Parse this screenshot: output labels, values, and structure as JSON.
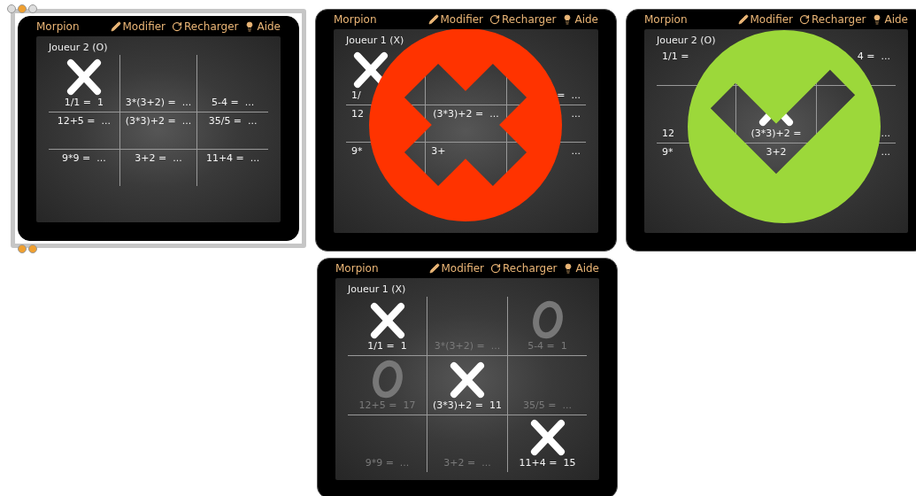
{
  "widgets": [
    {
      "title": "Morpion",
      "editing": true,
      "kind": "plain",
      "toolbar": [
        {
          "kind": "edit",
          "label": "Modifier"
        },
        {
          "kind": "reload",
          "label": "Recharger"
        },
        {
          "kind": "help",
          "label": "Aide"
        }
      ],
      "player": "Joueur 2 (O)",
      "cells": [
        {
          "kind": "cross",
          "text": "1/1 =  1",
          "dimmed": false
        },
        {
          "kind": "empty",
          "text": "3*(3+2) =  ...",
          "dimmed": false
        },
        {
          "kind": "empty",
          "text": "5-4 =  ...",
          "dimmed": false
        },
        {
          "kind": "empty",
          "text": "12+5 =  ...",
          "dimmed": false
        },
        {
          "kind": "empty",
          "text": "(3*3)+2 =  ...",
          "dimmed": false
        },
        {
          "kind": "empty",
          "text": "35/5 =  ...",
          "dimmed": false
        },
        {
          "kind": "empty",
          "text": "9*9 =  ...",
          "dimmed": false
        },
        {
          "kind": "empty",
          "text": "3+2 =  ...",
          "dimmed": false
        },
        {
          "kind": "empty",
          "text": "11+4 =  ...",
          "dimmed": false
        }
      ]
    },
    {
      "title": "Morpion",
      "editing": false,
      "kind": "wrong",
      "toolbar": [
        {
          "kind": "edit",
          "label": "Modifier"
        },
        {
          "kind": "reload",
          "label": "Recharger"
        },
        {
          "kind": "help",
          "label": "Aide"
        }
      ],
      "player": "Joueur 1 (X)",
      "cells": [
        {
          "kind": "cross",
          "text": "1/",
          "dimmed": false
        },
        {
          "kind": "empty"
        },
        {
          "kind": "empty",
          "text": "=  ...",
          "dimmed": false
        },
        {
          "kind": "empty",
          "text": "12",
          "dimmed": false
        },
        {
          "kind": "empty",
          "text": "(3*3)+2 =  ...",
          "dimmed": false
        },
        {
          "kind": "empty",
          "text": "...",
          "dimmed": false
        },
        {
          "kind": "empty",
          "text": "9*",
          "dimmed": false
        },
        {
          "kind": "empty",
          "text": "3+",
          "dimmed": false
        },
        {
          "kind": "empty",
          "text": "...",
          "dimmed": false
        }
      ]
    },
    {
      "title": "Morpion",
      "editing": false,
      "kind": "right",
      "toolbar": [
        {
          "kind": "edit",
          "label": "Modifier"
        },
        {
          "kind": "reload",
          "label": "Recharger"
        },
        {
          "kind": "help",
          "label": "Aide"
        }
      ],
      "player": "Joueur 2 (O)",
      "cells": [
        {
          "kind": "empty",
          "text": "1/1 =",
          "dimmed": false
        },
        {
          "kind": "empty"
        },
        {
          "kind": "empty",
          "text": "4 =  ...",
          "dimmed": false
        },
        {
          "kind": "empty",
          "text": "12",
          "dimmed": false
        },
        {
          "kind": "cross",
          "text": "(3*3)+2 =",
          "dimmed": false
        },
        {
          "kind": "empty",
          "text": "...",
          "dimmed": false
        },
        {
          "kind": "empty",
          "text": "9*",
          "dimmed": false
        },
        {
          "kind": "empty",
          "text": "3+2",
          "dimmed": false
        },
        {
          "kind": "empty",
          "text": "...",
          "dimmed": false
        }
      ]
    },
    {
      "title": "Morpion",
      "editing": false,
      "kind": "plain",
      "toolbar": [
        {
          "kind": "edit",
          "label": "Modifier"
        },
        {
          "kind": "reload",
          "label": "Recharger"
        },
        {
          "kind": "help",
          "label": "Aide"
        }
      ],
      "player": "Joueur 1 (X)",
      "cells": [
        {
          "kind": "cross",
          "text": "1/1 =  1",
          "dimmed": false
        },
        {
          "kind": "empty",
          "text": "3*(3+2) =  ...",
          "dimmed": true
        },
        {
          "kind": "circle",
          "text": "5-4 =  1",
          "dimmed": true
        },
        {
          "kind": "circle",
          "text": "12+5 =  17",
          "dimmed": true
        },
        {
          "kind": "cross",
          "text": "(3*3)+2 =  11",
          "dimmed": false
        },
        {
          "kind": "empty",
          "text": "35/5 =  ...",
          "dimmed": true
        },
        {
          "kind": "empty",
          "text": "9*9 =  ...",
          "dimmed": true
        },
        {
          "kind": "empty",
          "text": "3+2 =  ...",
          "dimmed": true
        },
        {
          "kind": "cross",
          "text": "11+4 =  15",
          "dimmed": false
        }
      ]
    }
  ]
}
